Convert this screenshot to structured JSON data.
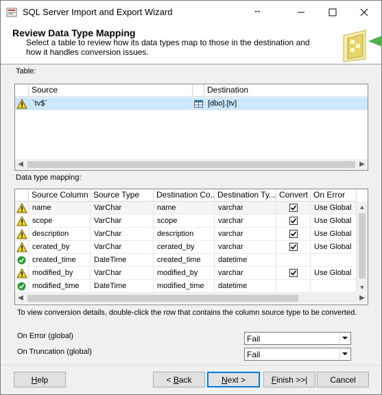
{
  "window": {
    "title": "SQL Server Import and Export Wizard",
    "min_glyph": "—",
    "max_glyph": "☐",
    "close_glyph": "✕",
    "resize_glyph": "↔"
  },
  "header": {
    "title": "Review Data Type Mapping",
    "description": "Select a table to review how its data types map to those in the destination and how it handles conversion issues."
  },
  "table_section": {
    "label": "Table:",
    "columns": [
      "Source",
      "Destination"
    ],
    "rows": [
      {
        "status": "warning",
        "source": "`tv$`",
        "destination": "[dbo].[tv]"
      }
    ]
  },
  "mapping_section": {
    "label": "Data type mapping:",
    "columns": [
      "Source Column",
      "Source Type",
      "Destination Co...",
      "Destination Ty...",
      "Convert",
      "On Error"
    ],
    "rows": [
      {
        "status": "warning",
        "source_column": "name",
        "source_type": "VarChar",
        "dest_column": "name",
        "dest_type": "varchar",
        "convert": true,
        "on_error": "Use Global"
      },
      {
        "status": "warning",
        "source_column": "scope",
        "source_type": "VarChar",
        "dest_column": "scope",
        "dest_type": "varchar",
        "convert": true,
        "on_error": "Use Global"
      },
      {
        "status": "warning",
        "source_column": "description",
        "source_type": "VarChar",
        "dest_column": "description",
        "dest_type": "varchar",
        "convert": true,
        "on_error": "Use Global"
      },
      {
        "status": "warning",
        "source_column": "cerated_by",
        "source_type": "VarChar",
        "dest_column": "cerated_by",
        "dest_type": "varchar",
        "convert": true,
        "on_error": "Use Global"
      },
      {
        "status": "ok",
        "source_column": "created_time",
        "source_type": "DateTime",
        "dest_column": "created_time",
        "dest_type": "datetime",
        "convert": false,
        "on_error": ""
      },
      {
        "status": "warning",
        "source_column": "modified_by",
        "source_type": "VarChar",
        "dest_column": "modified_by",
        "dest_type": "varchar",
        "convert": true,
        "on_error": "Use Global"
      },
      {
        "status": "ok",
        "source_column": "modified_time",
        "source_type": "DateTime",
        "dest_column": "modified_time",
        "dest_type": "datetime",
        "convert": false,
        "on_error": ""
      }
    ]
  },
  "hint_text": "To view conversion details, double-click the row that contains the column source type to be converted.",
  "on_error": {
    "label": "On Error (global)",
    "value": "Fail"
  },
  "on_truncation": {
    "label": "On Truncation (global)",
    "value": "Fail"
  },
  "buttons": {
    "help": {
      "mnemonic": "H",
      "rest": "elp"
    },
    "back": {
      "prefix": "< ",
      "mnemonic": "B",
      "rest": "ack"
    },
    "next": {
      "mnemonic": "N",
      "rest": "ext >"
    },
    "finish": {
      "mnemonic": "F",
      "rest": "inish >>|"
    },
    "cancel": "Cancel"
  },
  "colors": {
    "selected_row": "#cce8ff",
    "default_button_border": "#0078d7",
    "warning_yellow": "#f7d21b",
    "ok_green": "#2e9e3b"
  }
}
